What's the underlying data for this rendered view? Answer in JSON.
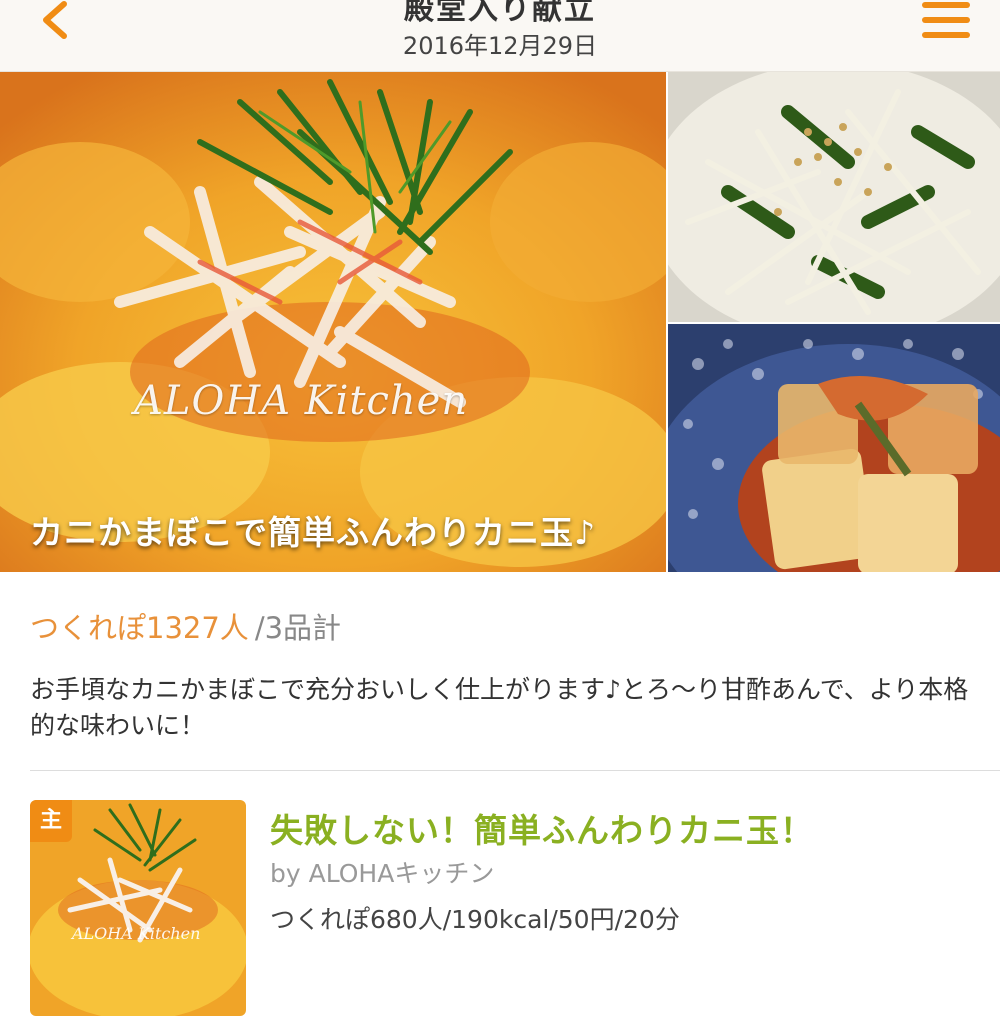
{
  "header": {
    "title": "殿堂入り献立",
    "date": "2016年12月29日"
  },
  "hero": {
    "caption": "カニかまぼこで簡単ふんわりカニ玉♪",
    "watermark": "ALOHA Kitchen"
  },
  "stats": {
    "tsukurepo": "つくれぽ1327人",
    "total": "/3品計"
  },
  "description": "お手頃なカニかまぼこで充分おいしく仕上がります♪とろ〜り甘酢あんで、より本格的な味わいに！",
  "recipe": {
    "badge": "主",
    "thumb_watermark": "ALOHA Kitchen",
    "title": "失敗しない！簡単ふんわりカニ玉！",
    "author": "by ALOHAキッチン",
    "meta": "つくれぽ680人/190kcal/50円/20分"
  },
  "colors": {
    "accent": "#f08c14",
    "stats_count": "#e8913a",
    "recipe_title": "#8ab021"
  }
}
